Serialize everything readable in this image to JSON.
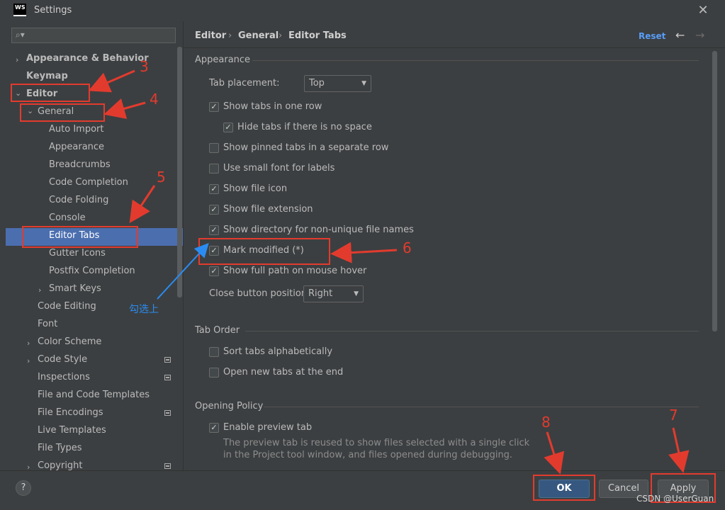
{
  "window": {
    "title": "Settings",
    "app_logo_text": "WS",
    "close": "✕"
  },
  "sidebar": {
    "search_placeholder": "",
    "search_icon": "🔍",
    "items": [
      {
        "label": "Appearance & Behavior"
      },
      {
        "label": "Keymap"
      },
      {
        "label": "Editor"
      },
      {
        "label": "General"
      },
      {
        "label": "Auto Import"
      },
      {
        "label": "Appearance"
      },
      {
        "label": "Breadcrumbs"
      },
      {
        "label": "Code Completion"
      },
      {
        "label": "Code Folding"
      },
      {
        "label": "Console"
      },
      {
        "label": "Editor Tabs"
      },
      {
        "label": "Gutter Icons"
      },
      {
        "label": "Postfix Completion"
      },
      {
        "label": "Smart Keys"
      },
      {
        "label": "Code Editing"
      },
      {
        "label": "Font"
      },
      {
        "label": "Color Scheme"
      },
      {
        "label": "Code Style"
      },
      {
        "label": "Inspections"
      },
      {
        "label": "File and Code Templates"
      },
      {
        "label": "File Encodings"
      },
      {
        "label": "Live Templates"
      },
      {
        "label": "File Types"
      },
      {
        "label": "Copyright"
      }
    ],
    "selected": "Editor Tabs"
  },
  "header": {
    "breadcrumbs": [
      "Editor",
      "General",
      "Editor Tabs"
    ],
    "separator": "›",
    "reset_label": "Reset",
    "back": "←",
    "forward": "→"
  },
  "appearance_section": {
    "title": "Appearance",
    "tab_placement_label": "Tab placement:",
    "tab_placement_value": "Top",
    "options": [
      {
        "label": "Show tabs in one row",
        "checked": true
      },
      {
        "label": "Hide tabs if there is no space",
        "checked": true
      },
      {
        "label": "Show pinned tabs in a separate row",
        "checked": false
      },
      {
        "label": "Use small font for labels",
        "checked": false
      },
      {
        "label": "Show file icon",
        "checked": true
      },
      {
        "label": "Show file extension",
        "checked": true
      },
      {
        "label": "Show directory for non-unique file names",
        "checked": true
      },
      {
        "label": "Mark modified (*)",
        "checked": true
      },
      {
        "label": "Show full path on mouse hover",
        "checked": true
      }
    ],
    "close_button_label": "Close button position:",
    "close_button_value": "Right"
  },
  "tab_order_section": {
    "title": "Tab Order",
    "options": [
      {
        "label": "Sort tabs alphabetically",
        "checked": false
      },
      {
        "label": "Open new tabs at the end",
        "checked": false
      }
    ]
  },
  "opening_policy_section": {
    "title": "Opening Policy",
    "options": [
      {
        "label": "Enable preview tab",
        "checked": true
      }
    ],
    "description_line1": "The preview tab is reused to show files selected with a single click",
    "description_line2": "in the Project tool window, and files opened during debugging."
  },
  "footer": {
    "help": "?",
    "ok_label": "OK",
    "cancel_label": "Cancel",
    "apply_label": "Apply"
  },
  "annotations": {
    "numbers": [
      "3",
      "4",
      "5",
      "6",
      "7",
      "8"
    ],
    "note": "勾选上",
    "color_red": "#e23b2e",
    "color_blue": "#2a8cf2"
  },
  "watermark": "CSDN @UserGuan"
}
